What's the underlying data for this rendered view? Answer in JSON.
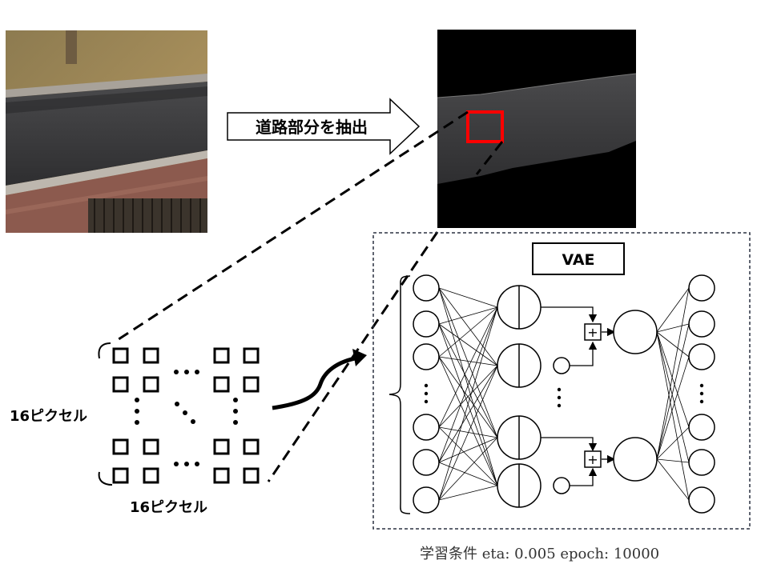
{
  "arrow_label": "道路部分を抽出",
  "vae_label": "VAE",
  "pixel_label_left": "16ピクセル",
  "pixel_label_bottom": "16ピクセル",
  "training_conditions": "学習条件 eta: 0.005 epoch: 10000",
  "plus_symbol": "+",
  "colors": {
    "highlight_box": "#ff0000",
    "road": "#3a3a3c",
    "grass": "#9a8455",
    "mask_background": "#000000"
  }
}
